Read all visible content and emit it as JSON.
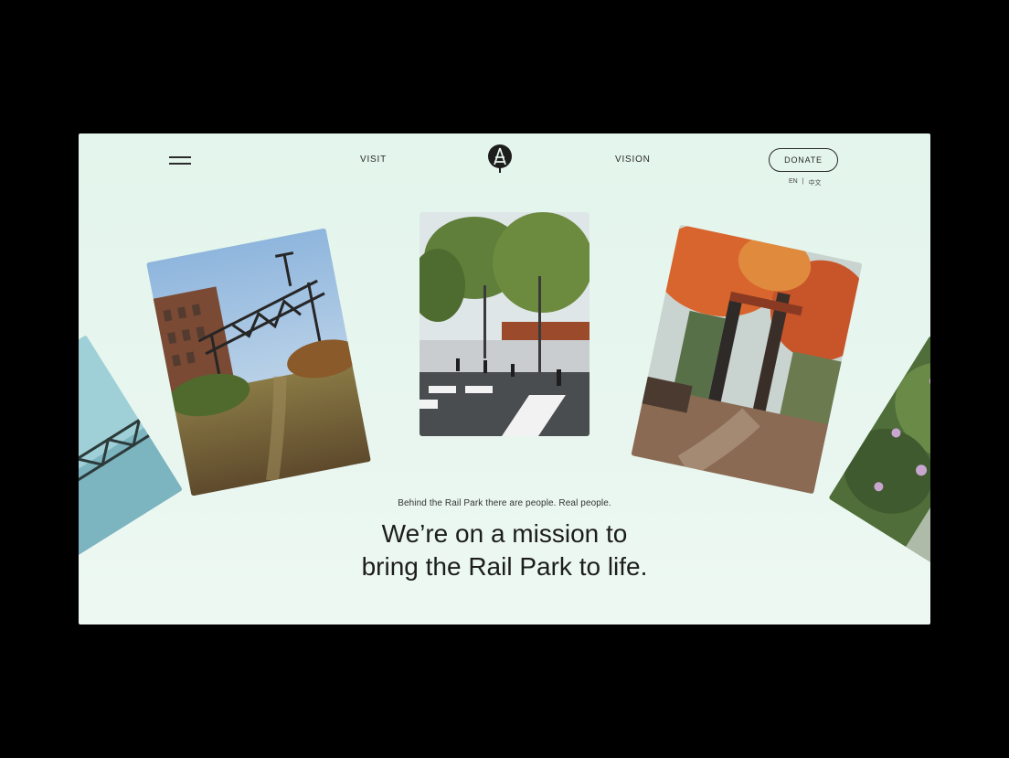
{
  "nav": {
    "menu_icon": "hamburger-menu-icon",
    "visit_label": "VISIT",
    "vision_label": "VISION",
    "logo_icon": "rail-park-logo",
    "donate_label": "DONATE",
    "lang_en": "EN",
    "lang_separator": "|",
    "lang_zh": "中文"
  },
  "gallery": {
    "photos": [
      {
        "subject": "overgrown rail line with overhead catenary gantries"
      },
      {
        "subject": "tree-lined park plaza with crosswalk and bollards"
      },
      {
        "subject": "rust-red steel structures with autumn foliage"
      },
      {
        "subject": "steel trestle bridge"
      },
      {
        "subject": "flowering greenery"
      }
    ]
  },
  "hero": {
    "tagline": "Behind the Rail Park there are people. Real people.",
    "headline_line1": "We’re on a mission to",
    "headline_line2": "bring the Rail Park to life."
  },
  "colors": {
    "background": "#000000",
    "frame_bg": "#e4f5ec",
    "text": "#1d1d1d"
  }
}
